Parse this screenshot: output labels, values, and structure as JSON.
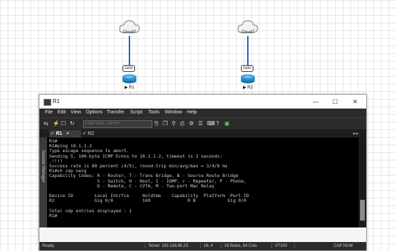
{
  "topology": {
    "cloud_left_label": "Cloud7",
    "cloud_right_label": "Cloud7",
    "port_left": "Gi0/0",
    "port_right": "Gi0/0",
    "router_left_label": "▶ R1",
    "router_right_label": "▶ R2"
  },
  "window": {
    "title": "R1",
    "minimize": "—",
    "maximize": "☐",
    "close": "✕"
  },
  "menu": [
    "File",
    "Edit",
    "View",
    "Options",
    "Transfer",
    "Script",
    "Tools",
    "Window",
    "Help"
  ],
  "toolbar": {
    "host_placeholder": "Enter host <Alt+R>"
  },
  "tabs": {
    "active": "R1",
    "close": "×",
    "other": "R2",
    "nav": "◂ ▸"
  },
  "session_manager": "Session Manager",
  "terminal_lines": [
    "R1#",
    "R1#ping 10.1.1.2",
    "Type escape sequence to abort.",
    "Sending 5, 100-byte ICMP Echos to 10.1.1.2, timeout is 2 seconds:",
    ".!!!!",
    "Success rate is 80 percent (4/5), round-trip min/avg/max = 3/4/8 ms",
    "R1#sh cdp neig",
    "Capability Codes: R - Router, T - Trans Bridge, B - Source Route Bridge",
    "                  S - Switch, H - Host, I - IGMP, r - Repeater, P - Phone,",
    "                  D - Remote, C - CVTA, M - Two-port Mac Relay",
    "",
    "Device ID        Local Intrfce     Holdtme    Capability  Platform  Port ID",
    "R2               Gig 0/0           169              R B            Gig 0/0",
    "",
    "Total cdp entries displayed : 1",
    "R1#"
  ],
  "status": {
    "ready": "Ready",
    "connection": "Telnet: 192.168.90.23",
    "cursor_pos": "16,  4",
    "size": "16 Rows, 84 Cols",
    "terminal_type": "VT100",
    "caps": "CAP  NUM"
  }
}
